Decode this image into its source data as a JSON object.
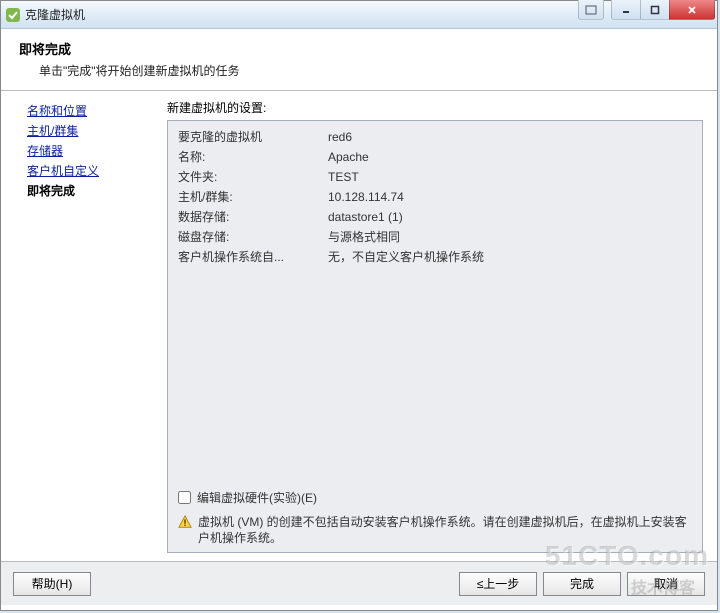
{
  "window": {
    "title": "克隆虚拟机"
  },
  "header": {
    "title": "即将完成",
    "subtitle": "单击\"完成\"将开始创建新虚拟机的任务"
  },
  "sidebar": {
    "items": [
      {
        "label": "名称和位置"
      },
      {
        "label": "主机/群集"
      },
      {
        "label": "存储器"
      },
      {
        "label": "客户机自定义"
      },
      {
        "label": "即将完成"
      }
    ]
  },
  "content": {
    "heading": "新建虚拟机的设置:",
    "rows": [
      {
        "label": "要克隆的虚拟机",
        "value": "red6"
      },
      {
        "label": "名称:",
        "value": "Apache"
      },
      {
        "label": "文件夹:",
        "value": "TEST"
      },
      {
        "label": "主机/群集:",
        "value": "10.128.114.74"
      },
      {
        "label": "数据存储:",
        "value": "datastore1 (1)"
      },
      {
        "label": "磁盘存储:",
        "value": "与源格式相同"
      },
      {
        "label": "客户机操作系统自...",
        "value": "无，不自定义客户机操作系统"
      }
    ],
    "checkbox_label": "编辑虚拟硬件(实验)(E)",
    "warning_text": "虚拟机 (VM) 的创建不包括自动安装客户机操作系统。请在创建虚拟机后，在虚拟机上安装客户机操作系统。"
  },
  "footer": {
    "help": "帮助(H)",
    "back": "≤上一步",
    "finish": "完成",
    "cancel": "取消"
  },
  "watermark": {
    "main": "51CTO.com",
    "sub": "技术博客"
  }
}
